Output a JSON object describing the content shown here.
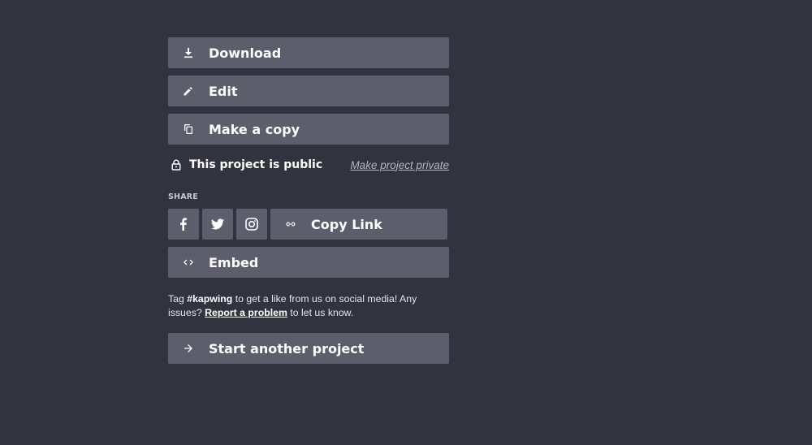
{
  "actions": {
    "download_label": "Download",
    "edit_label": "Edit",
    "copy_label": "Make a copy"
  },
  "privacy": {
    "status": "This project is public",
    "toggle_link": "Make project private"
  },
  "share": {
    "label": "SHARE",
    "copy_link_label": "Copy Link",
    "embed_label": "Embed"
  },
  "footer": {
    "tag_prefix": "Tag ",
    "hashtag": "#kapwing",
    "tag_middle": " to get a like from us on social media! Any issues? ",
    "report_link": "Report a problem",
    "tag_suffix": " to let us know."
  },
  "start_label": "Start another project",
  "icons": [
    "download-icon",
    "edit-icon",
    "copy-icon",
    "lock-icon",
    "facebook-icon",
    "twitter-icon",
    "instagram-icon",
    "link-icon",
    "embed-icon",
    "arrow-right-icon"
  ],
  "colors": {
    "background": "#31343f",
    "button": "#5c5f6b",
    "text": "#ffffff",
    "muted_link": "#b3b6c0"
  }
}
